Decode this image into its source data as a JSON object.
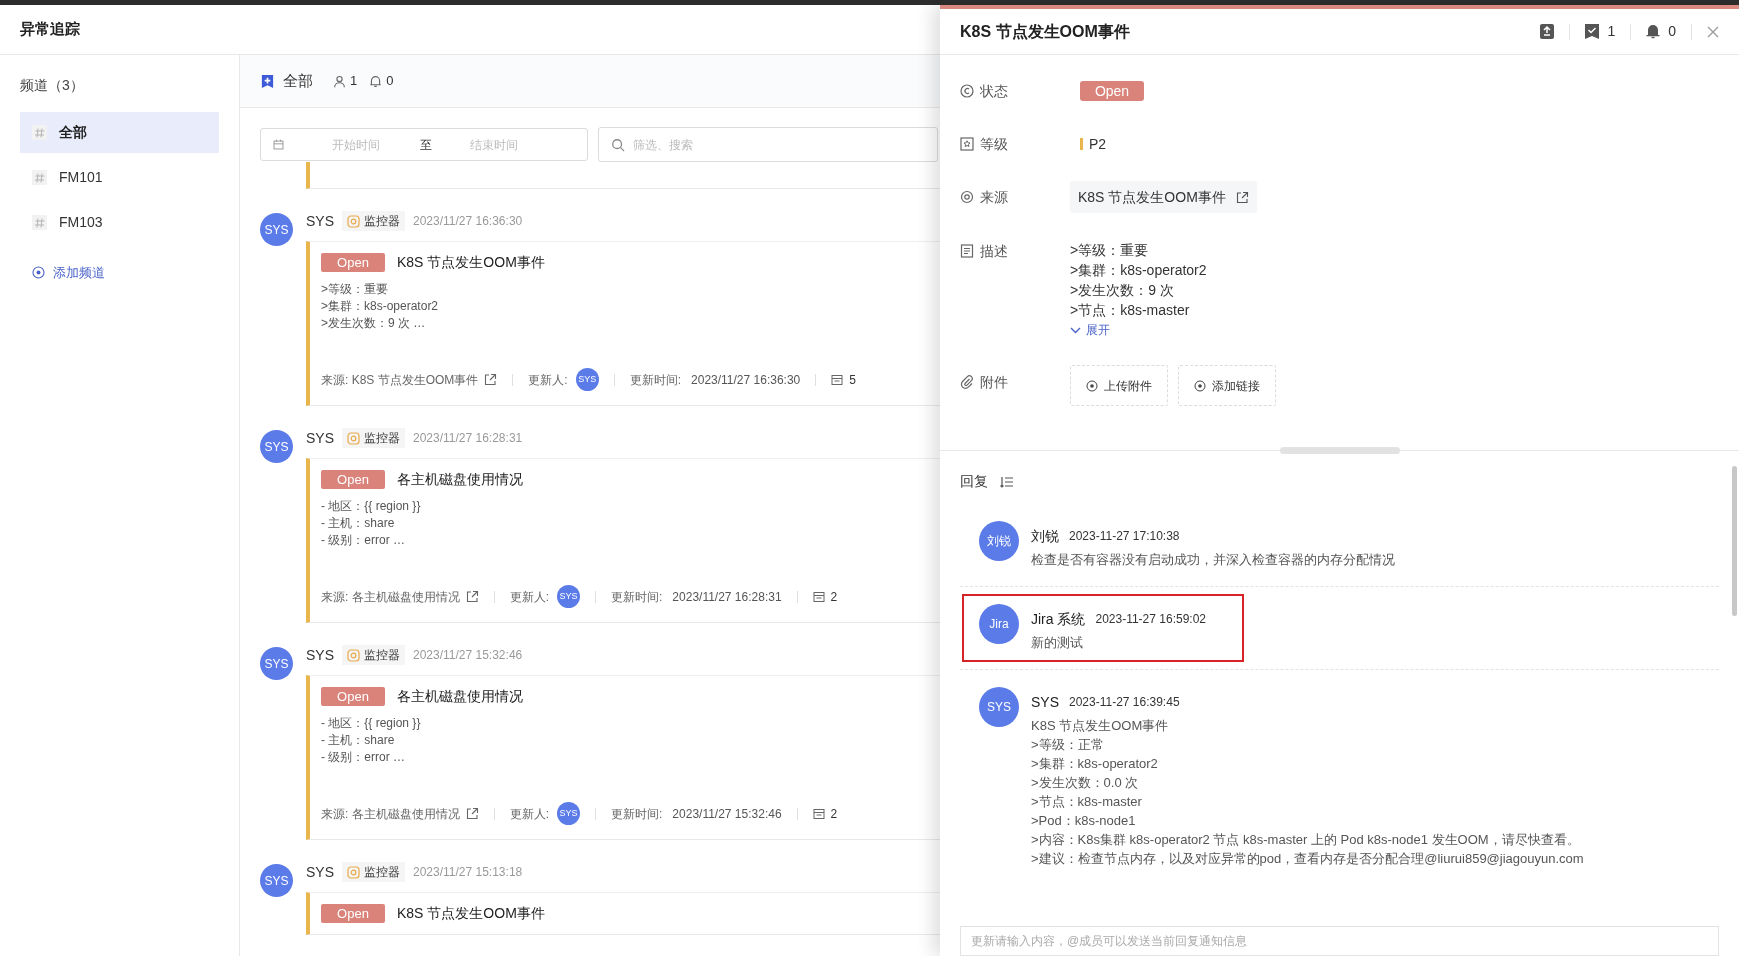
{
  "app_title": "异常追踪",
  "sidebar": {
    "heading": "频道（3）",
    "items": [
      {
        "label": "全部",
        "selected": true
      },
      {
        "label": "FM101",
        "selected": false
      },
      {
        "label": "FM103",
        "selected": false
      }
    ],
    "add_label": "添加频道"
  },
  "channel_header": {
    "title": "全部",
    "members": "1",
    "subscribers": "0"
  },
  "filters": {
    "start_placeholder": "开始时间",
    "separator": "至",
    "end_placeholder": "结束时间",
    "search_placeholder": "筛选、搜索"
  },
  "feed": [
    {
      "avatar": "SYS",
      "author": "SYS",
      "tag": "监控器",
      "time": "2023/11/27 16:36:30",
      "card": {
        "status": "Open",
        "title": "K8S 节点发生OOM事件",
        "lines": [
          ">等级：重要",
          ">集群：k8s-operator2",
          ">发生次数：9 次  …"
        ],
        "source_label": "来源:",
        "source": "K8S 节点发生OOM事件",
        "updater_label": "更新人:",
        "updater": "SYS",
        "updated_label": "更新时间:",
        "updated": "2023/11/27 16:36:30",
        "replies": "5"
      }
    },
    {
      "avatar": "SYS",
      "author": "SYS",
      "tag": "监控器",
      "time": "2023/11/27 16:28:31",
      "card": {
        "status": "Open",
        "title": "各主机磁盘使用情况",
        "lines": [
          "- 地区：{{ region }}",
          "- 主机：share",
          "- 级别：error  …"
        ],
        "source_label": "来源:",
        "source": "各主机磁盘使用情况",
        "updater_label": "更新人:",
        "updater": "SYS",
        "updated_label": "更新时间:",
        "updated": "2023/11/27 16:28:31",
        "replies": "2"
      }
    },
    {
      "avatar": "SYS",
      "author": "SYS",
      "tag": "监控器",
      "time": "2023/11/27 15:32:46",
      "card": {
        "status": "Open",
        "title": "各主机磁盘使用情况",
        "lines": [
          "- 地区：{{ region }}",
          "- 主机：share",
          "- 级别：error  …"
        ],
        "source_label": "来源:",
        "source": "各主机磁盘使用情况",
        "updater_label": "更新人:",
        "updater": "SYS",
        "updated_label": "更新时间:",
        "updated": "2023/11/27 15:32:46",
        "replies": "2"
      }
    },
    {
      "avatar": "SYS",
      "author": "SYS",
      "tag": "监控器",
      "time": "2023/11/27 15:13:18",
      "card": {
        "status": "Open",
        "title": "K8S 节点发生OOM事件"
      }
    }
  ],
  "detail": {
    "title": "K8S 节点发生OOM事件",
    "done_count": "1",
    "bell_count": "0",
    "fields": [
      {
        "kind": "status",
        "label": "状态",
        "value": "Open"
      },
      {
        "kind": "level",
        "label": "等级",
        "value": "P2"
      },
      {
        "kind": "source",
        "label": "来源",
        "value": "K8S 节点发生OOM事件"
      },
      {
        "kind": "description",
        "label": "描述",
        "lines": [
          ">等级：重要",
          ">集群：k8s-operator2",
          ">发生次数：9 次",
          ">节点：k8s-master"
        ],
        "expand": "展开"
      },
      {
        "kind": "attachments",
        "label": "附件",
        "buttons": [
          "上传附件",
          "添加链接"
        ]
      }
    ],
    "replies_heading": "回复",
    "replies": [
      {
        "avatar": "刘锐",
        "author": "刘锐",
        "time": "2023-11-27 17:10:38",
        "lines": [
          "检查是否有容器没有启动成功，并深入检查容器的内存分配情况"
        ],
        "highlighted": false
      },
      {
        "avatar": "Jira",
        "author": "Jira 系统",
        "time": "2023-11-27 16:59:02",
        "lines": [
          "新的测试"
        ],
        "highlighted": true
      },
      {
        "avatar": "SYS",
        "author": "SYS",
        "time": "2023-11-27 16:39:45",
        "lines": [
          "K8S 节点发生OOM事件",
          ">等级：正常",
          ">集群：k8s-operator2",
          ">发生次数：0.0 次",
          ">节点：k8s-master",
          ">Pod：k8s-node1",
          ">内容：K8s集群 k8s-operator2 节点 k8s-master 上的 Pod k8s-node1 发生OOM，请尽快查看。",
          ">建议：检查节点内存，以及对应异常的pod，查看内存是否分配合理@liurui859@jiagouyun.com"
        ],
        "highlighted": false
      }
    ],
    "reply_input": {
      "placeholder": "更新请输入内容，@成员可以发送当前回复通知信息"
    }
  }
}
